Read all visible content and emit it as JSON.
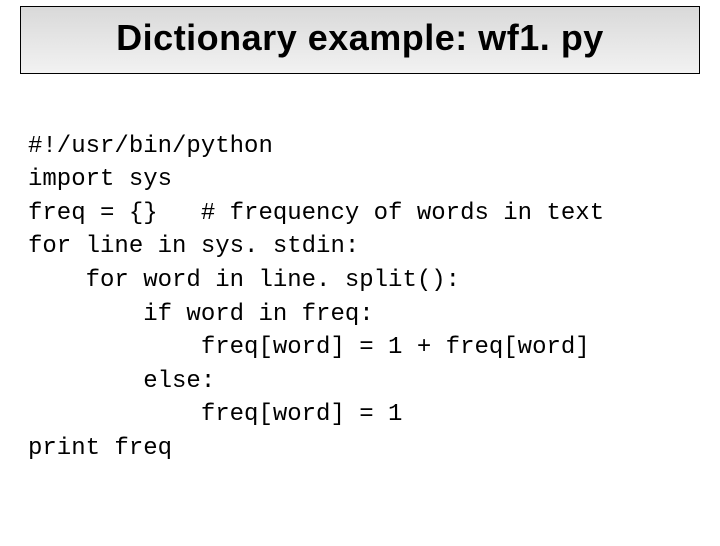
{
  "title": "Dictionary example: wf1. py",
  "code_lines": [
    "#!/usr/bin/python",
    "import sys",
    "freq = {}   # frequency of words in text",
    "for line in sys. stdin:",
    "    for word in line. split():",
    "        if word in freq:",
    "            freq[word] = 1 + freq[word]",
    "        else:",
    "            freq[word] = 1",
    "print freq"
  ]
}
